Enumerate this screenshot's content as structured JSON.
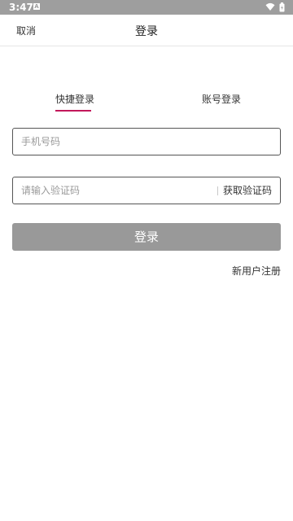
{
  "status_bar": {
    "time": "3:47",
    "notification_icon": "A"
  },
  "header": {
    "cancel_label": "取消",
    "title": "登录"
  },
  "tabs": [
    {
      "label": "快捷登录",
      "active": true
    },
    {
      "label": "账号登录",
      "active": false
    }
  ],
  "form": {
    "phone_placeholder": "手机号码",
    "phone_value": "",
    "code_placeholder": "请输入验证码",
    "code_value": "",
    "get_code_label": "获取验证码",
    "login_label": "登录",
    "register_label": "新用户注册"
  },
  "colors": {
    "status_bar": "#9e9e9e",
    "tab_indicator": "#c2185b",
    "login_button": "#999999"
  }
}
